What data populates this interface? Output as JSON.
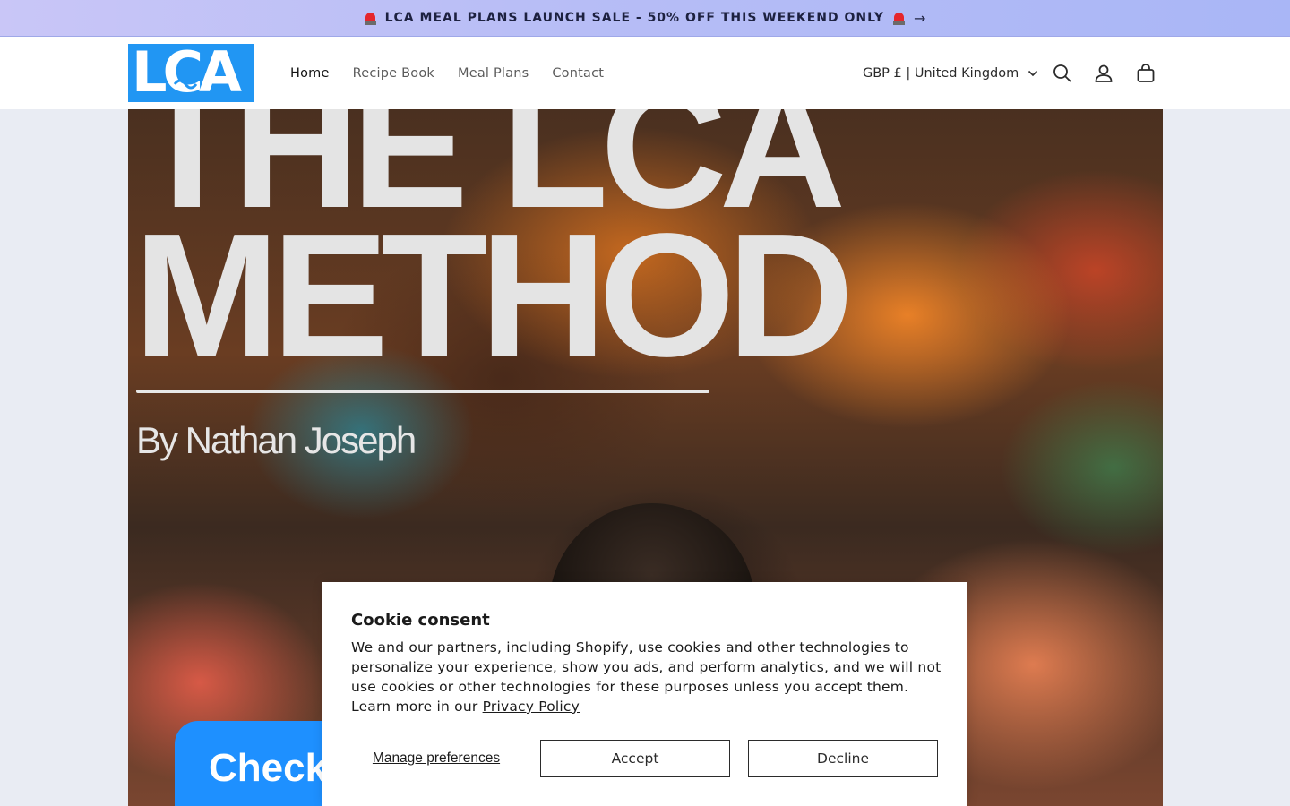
{
  "announcement": {
    "text": "LCA MEAL PLANS LAUNCH SALE - 50% OFF THIS WEEKEND ONLY",
    "arrow": "→",
    "icon": "siren-icon"
  },
  "header": {
    "logo_text": "LCA",
    "brand_color": "#2196f3",
    "nav": [
      {
        "label": "Home",
        "active": true
      },
      {
        "label": "Recipe Book"
      },
      {
        "label": "Meal Plans"
      },
      {
        "label": "Contact"
      }
    ],
    "locale": "GBP £ | United Kingdom",
    "icons": [
      "search-icon",
      "account-icon",
      "cart-icon"
    ]
  },
  "hero": {
    "title_line1": "THE LCA",
    "title_line2": "METHOD",
    "byline": "By Nathan Joseph",
    "cta_text": "Check",
    "cta_color": "#1e90ff"
  },
  "cookie": {
    "title": "Cookie consent",
    "body": "We and our partners, including Shopify, use cookies and other technologies to personalize your experience, show you ads, and perform analytics, and we will not use cookies or other technologies for these purposes unless you accept them. Learn more in our ",
    "policy_link": "Privacy Policy",
    "manage_label": "Manage preferences",
    "accept_label": "Accept",
    "decline_label": "Decline"
  }
}
